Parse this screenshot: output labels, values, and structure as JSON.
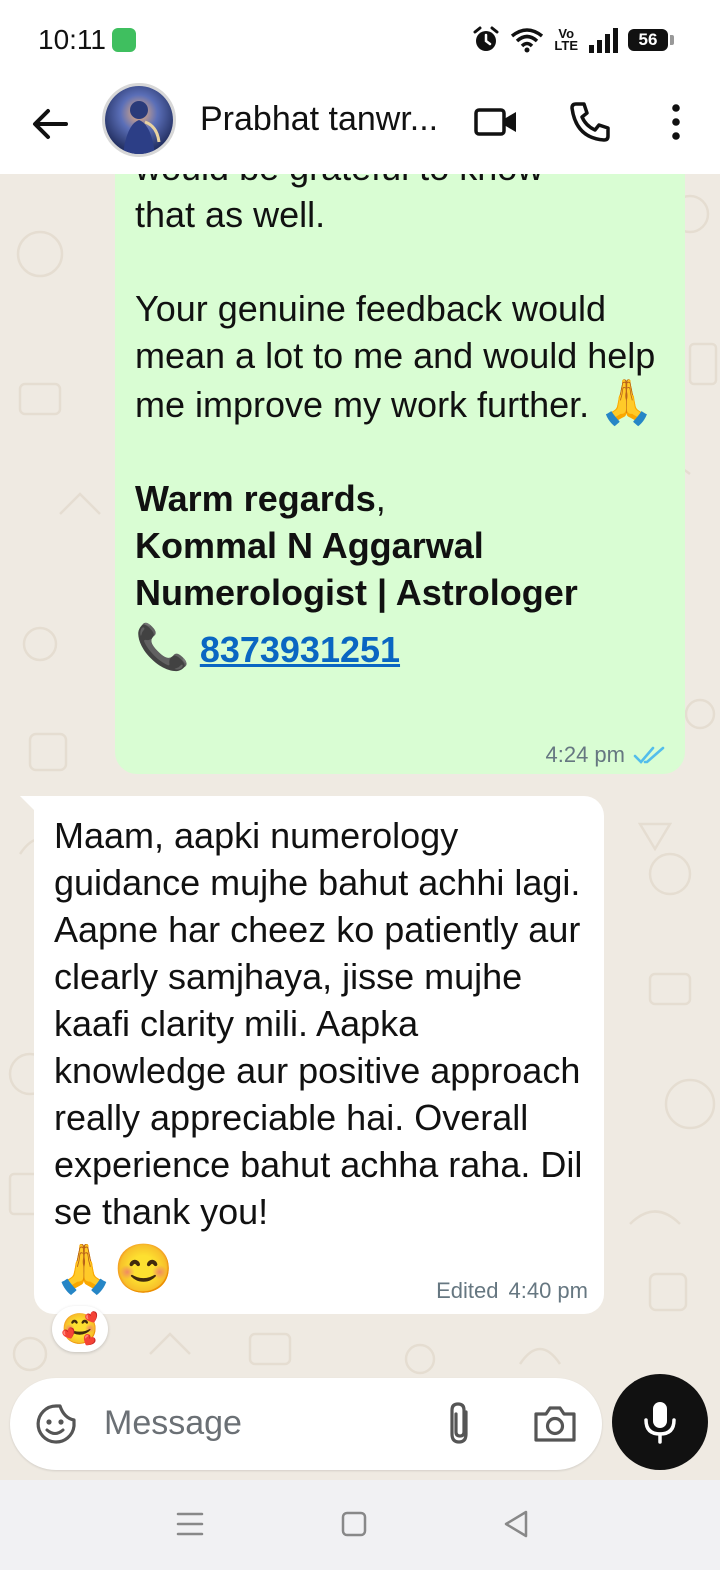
{
  "status_bar": {
    "time": "10:11",
    "lte_label_top": "Vo",
    "lte_label_bottom": "LTE",
    "battery": "56"
  },
  "header": {
    "contact_name": "Prabhat tanwr..."
  },
  "messages": {
    "outgoing": {
      "cut_line": "would be grateful to know",
      "line1": "that as well.",
      "para2": "Your genuine feedback would mean a lot to me and would help me improve my work further.",
      "para2_emoji": "🙏",
      "regards": "Warm regards",
      "regards_comma": ",",
      "name": "Kommal N Aggarwal",
      "title": "Numerologist | Astrologer",
      "phone_emoji": "📞",
      "phone": "8373931251",
      "time": "4:24 pm"
    },
    "incoming": {
      "text": "Maam, aapki numerology guidance mujhe bahut achhi lagi. Aapne har cheez ko patiently aur clearly samjhaya, jisse mujhe kaafi clarity mili. Aapka knowledge aur positive approach really appreciable hai. Overall experience bahut achha raha. Dil se thank you!",
      "emojis": "🙏😊",
      "edited_label": "Edited",
      "time": "4:40 pm",
      "reaction": "🥰"
    }
  },
  "composer": {
    "placeholder": "Message"
  },
  "colors": {
    "outgoing_bubble": "#d9fdd3",
    "incoming_bubble": "#ffffff",
    "link": "#0a66c2",
    "read_ticks": "#53bdeb",
    "chat_bg": "#efeae2"
  }
}
